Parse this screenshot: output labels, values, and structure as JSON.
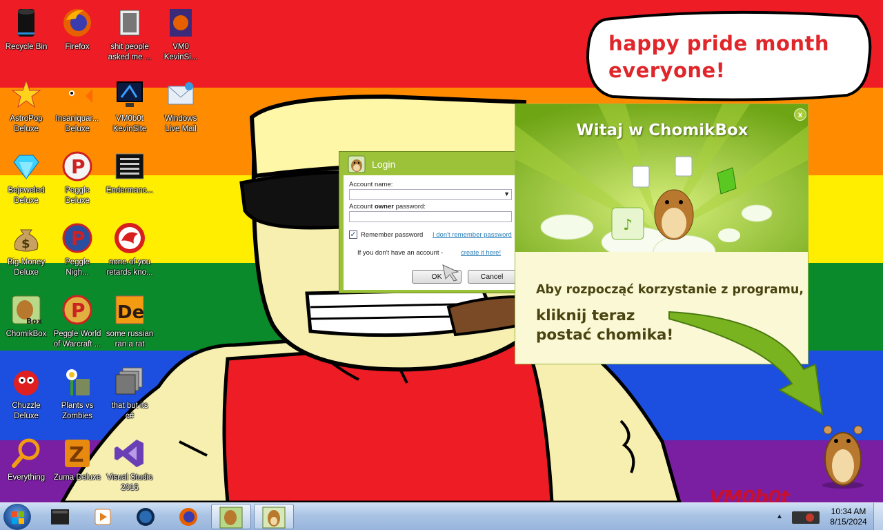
{
  "desktop": {
    "icons": [
      {
        "label": "Recycle Bin",
        "icon": "recycle-bin-icon"
      },
      {
        "label": "Firefox",
        "icon": "firefox-icon"
      },
      {
        "label": "shit people\nasked me ...",
        "icon": "folder-icon"
      },
      {
        "label": "VM0\nKevinSi...",
        "icon": "firefox-shortcut-icon"
      },
      {
        "label": "AstroPop\nDeluxe",
        "icon": "astropop-icon"
      },
      {
        "label": "Insaniquar...\nDeluxe",
        "icon": "insaniquarium-fish-icon"
      },
      {
        "label": "VM0b0t\nKevinSite",
        "icon": "monitor-icon"
      },
      {
        "label": "Windows\nLive Mail",
        "icon": "live-mail-icon"
      },
      {
        "label": "Bejeweled\nDeluxe",
        "icon": "gem-icon"
      },
      {
        "label": "Peggle\nDeluxe",
        "icon": "peggle-icon"
      },
      {
        "label": "Endermanc...",
        "icon": "terminal-icon"
      },
      {
        "label": "Big Money\nDeluxe",
        "icon": "money-bag-icon"
      },
      {
        "label": "Peggle\nNigh...",
        "icon": "peggle-nights-icon"
      },
      {
        "label": "none of you\nretards kno...",
        "icon": "red-dragon-icon"
      },
      {
        "label": "ChomikBox",
        "icon": "chomikbox-icon"
      },
      {
        "label": "Peggle World\nof Warcraft ...",
        "icon": "peggle-wow-icon"
      },
      {
        "label": "some russian\nran a rat",
        "icon": "de-icon"
      },
      {
        "label": "Chuzzle\nDeluxe",
        "icon": "chuzzle-icon"
      },
      {
        "label": "Plants vs\nZombies",
        "icon": "plants-vs-zombies-icon"
      },
      {
        "label": "that but its\nc#",
        "icon": "windows-stack-icon"
      },
      {
        "label": "Everything",
        "icon": "magnifier-icon"
      },
      {
        "label": "Zuma Deluxe",
        "icon": "zuma-icon"
      },
      {
        "label": "Visual Studio\n2015",
        "icon": "visual-studio-icon"
      }
    ]
  },
  "bubble": {
    "text": "happy pride month everyone!"
  },
  "login": {
    "title": "Login",
    "account_name_label": "Account name:",
    "account_name_value": "",
    "password_label_pre": "Account ",
    "password_label_bold": "owner",
    "password_label_post": " password:",
    "password_value": "",
    "remember_label": "Remember password",
    "remember_checked": true,
    "forgot_link": "I don't remember password",
    "no_account_text": "If you don't have an account - ",
    "create_link": "create it here!",
    "ok_label": "OK",
    "cancel_label": "Cancel"
  },
  "chomikbox": {
    "title": "Witaj w ChomikBox",
    "close_glyph": "x",
    "line1": "Aby rozpocząć korzystanie z programu,",
    "line2": "kliknij teraz\npostać chomika!"
  },
  "watermark": {
    "text": "VM0b0t"
  },
  "taskbar": {
    "items": [
      "explorer-icon",
      "media-player-icon",
      "globe-icon",
      "firefox-icon",
      "chomikbox-icon",
      "chomikbox-hamster-icon"
    ],
    "tray_arrow": "▲",
    "time": "10:34 AM",
    "date": "8/15/2024"
  },
  "colors": {
    "rainbow": [
      "#ee1c24",
      "#ff8c00",
      "#ffee00",
      "#0a8a2a",
      "#1c4fdf",
      "#7a1fa2"
    ],
    "login_frame": "#9cc23a",
    "chomik_green": "#8fbf1c",
    "bubble_text": "#e0262a"
  }
}
